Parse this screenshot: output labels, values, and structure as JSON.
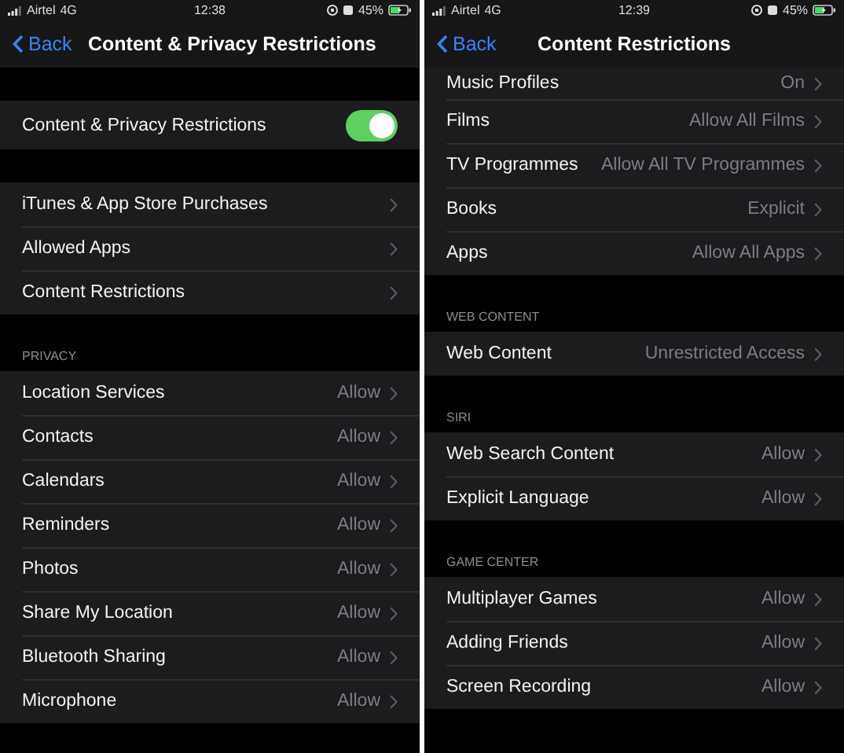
{
  "screens": [
    {
      "status_bar": {
        "carrier": "Airtel",
        "network": "4G",
        "time": "12:38",
        "battery": "45%"
      },
      "nav": {
        "back": "Back",
        "title": "Content & Privacy Restrictions"
      },
      "sections": [
        {
          "rows": [
            {
              "kind": "toggle",
              "label": "Content & Privacy Restrictions",
              "on": true
            }
          ]
        },
        {
          "rows": [
            {
              "kind": "link",
              "label": "iTunes & App Store Purchases"
            },
            {
              "kind": "link",
              "label": "Allowed Apps"
            },
            {
              "kind": "link",
              "label": "Content Restrictions"
            }
          ]
        },
        {
          "header": "PRIVACY",
          "rows": [
            {
              "kind": "link",
              "label": "Location Services",
              "value": "Allow"
            },
            {
              "kind": "link",
              "label": "Contacts",
              "value": "Allow"
            },
            {
              "kind": "link",
              "label": "Calendars",
              "value": "Allow"
            },
            {
              "kind": "link",
              "label": "Reminders",
              "value": "Allow"
            },
            {
              "kind": "link",
              "label": "Photos",
              "value": "Allow"
            },
            {
              "kind": "link",
              "label": "Share My Location",
              "value": "Allow"
            },
            {
              "kind": "link",
              "label": "Bluetooth Sharing",
              "value": "Allow"
            },
            {
              "kind": "link",
              "label": "Microphone",
              "value": "Allow"
            }
          ]
        }
      ]
    },
    {
      "status_bar": {
        "carrier": "Airtel",
        "network": "4G",
        "time": "12:39",
        "battery": "45%"
      },
      "nav": {
        "back": "Back",
        "title": "Content Restrictions"
      },
      "sections": [
        {
          "scrolled_under_bar": true,
          "rows": [
            {
              "kind": "link",
              "label": "Music Profiles",
              "value": "On"
            },
            {
              "kind": "link",
              "label": "Films",
              "value": "Allow All Films"
            },
            {
              "kind": "link",
              "label": "TV Programmes",
              "value": "Allow All TV Programmes"
            },
            {
              "kind": "link",
              "label": "Books",
              "value": "Explicit"
            },
            {
              "kind": "link",
              "label": "Apps",
              "value": "Allow All Apps"
            }
          ]
        },
        {
          "header": "WEB CONTENT",
          "rows": [
            {
              "kind": "link",
              "label": "Web Content",
              "value": "Unrestricted Access"
            }
          ]
        },
        {
          "header": "SIRI",
          "rows": [
            {
              "kind": "link",
              "label": "Web Search Content",
              "value": "Allow"
            },
            {
              "kind": "link",
              "label": "Explicit Language",
              "value": "Allow"
            }
          ]
        },
        {
          "header": "GAME CENTER",
          "rows": [
            {
              "kind": "link",
              "label": "Multiplayer Games",
              "value": "Allow"
            },
            {
              "kind": "link",
              "label": "Adding Friends",
              "value": "Allow"
            },
            {
              "kind": "link",
              "label": "Screen Recording",
              "value": "Allow"
            }
          ]
        }
      ]
    }
  ]
}
